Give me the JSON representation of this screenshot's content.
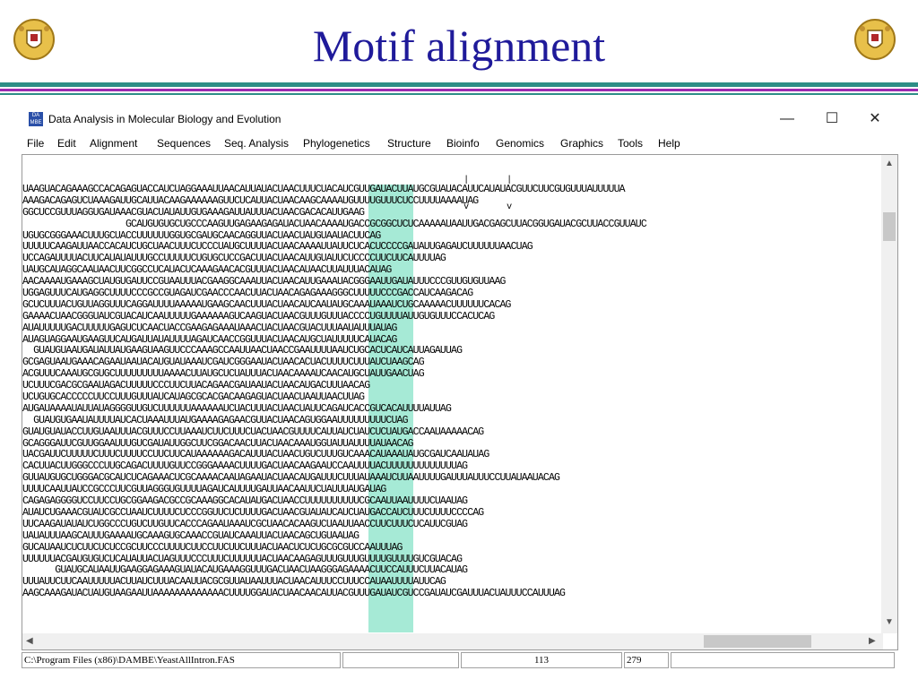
{
  "slide": {
    "title": "Motif alignment"
  },
  "window": {
    "title": "Data Analysis in Molecular Biology and Evolution",
    "icon_text": "DA MBE",
    "minimize": "—",
    "maximize": "☐",
    "close": "✕"
  },
  "menu": [
    "File",
    "Edit",
    "Alignment",
    "Sequences",
    "Seq. Analysis",
    "Phylogenetics",
    "Structure",
    "Bioinfo",
    "Genomics",
    "Graphics",
    "Tools",
    "Help"
  ],
  "markers": {
    "bars": "                                                                                  |       |",
    "arrows": "                                                                                  v       v"
  },
  "sequences": [
    "UAAGUACAGAAAGCCACAGAGUACCAUCUAGGAAAUUAACAUUAUACUAACUUUCUACAUCGUUGAUACUUAUGCGUAUACAUUCAUAUACGUUCUUCGUGUUUAUUUUUA",
    "AAAGACAGAGUCUAAAGAUUGCAUUACAAGAAAAAAGUUCUCAUUACUAACAAGCAAAAUGUUUUGUUUCUCCUUUUAAAAUAG",
    "GGCUCCGUUUAGGUGAUAAACGUACUAUAUUGUGAAAGAUUAUUUACUAACGACACAUUGAAG",
    "                   GCAUGUGUGCUGCCCAAGUUGAGAAGAGAUACUAACAAAAUGACCGCGGCUCUCAAAAAUAAUUGACGAGCUUACGGUGAUACGCUUACCGUUAUC",
    "UGUGCGGGAAACUUUGCUACCUUUUUUGGUGCGAUGCAACAGGUUACUAACUAUGUAAUACUUCAG",
    "UUUUUCAAGAUUAACCACAUCUGCUAACUUUCUCCCUAUGCUUUUACUAACAAAAUUAUUCUCACUCCCCGAUAUUGAGAUCUUUUUUAACUAG",
    "UCCAGAUUUUACUUCAUAUAUUUGCCUUUUUCUGUGCUCCGACUUACUAACAUUGUAUUCUCCCCUUCUUCAUUUUAG",
    "UAUGCAUAGGCAAUAACUUCGGCCUCAUACUCAAAGAACACGUUUACUAACAUAACUUAUUUACAUAG",
    "AACAAAAUGAAAGCUAUGUGAUUCCGUAAUUUACGAAGGCAAAUUACUAACAUUGAAAUACGGGAAUUGAUAUUUCCCGUUGUGUUAAG",
    "UGGAGUUUCAUGAGGCUUUUCCCGCCGUAGAUCGAACCCAACUUACUAACAGAGAAAGGGCUUUUUCCCGACCAUCAAGACAG",
    "GCUCUUUACUGUUAGGUUUCAGGAUUUUAAAAAUGAAGCAACUUUACUAACAUCAAUAUGCAAAUAAAUCUGCAAAAACUUUUUUCACAG",
    "GAAAACUAACGGGUAUCGUACAUCAAUUUUUGAAAAAAGUCAAGUACUAACGUUUGUUUACCCCUGUUUUAUUGUGUUUCCACUCAG",
    "AUAUUUUUGACUUUUUGAGUCUCAACUACCGAAGAGAAAUAAACUACUAACGUACUUUAAUAUUUAUAG",
    "AUAGUAGGAAUGAAGUUCAUGAUUAUAUUUUAGAUCAACCGGUUUACUAACAUGCUAUUUUUCAUACAG",
    "  GUAUGUAAUGAUAUUAUGAAGUAAGUUCCCAAAGCCAAUUAACUAACCGAAUUUUAAUCUGCACUCAUCAUUAGAUUAG",
    "GCGAGUAAUGAAACAGAAUAAUACAUGUAUAAAUCGAUCGGGAAUACUAACACUACUUUUCUUUAUCUAAGCAG",
    "ACGUUUCAAAUGCGUGCUUUUUUUUUAAAACUUAUGCUCUAUUUACUAACAAAAUCAACAUGCUAUUGAACUAG",
    "UCUUUCGACGCGAAUAGACUUUUUCCCUUCUUACAGAACGAUAAUACUAACAUGACUUUAACAG",
    "UCUGUGCACCCCCUUCCUUUGUUUAUCAUAGCGCACGACAAGAGUACUAACUAAUUAACUUAG",
    "AUGAUAAAAUAUUAUAGGGGUUGUCUUUUUUAAAAAAUCUACUUUACUAACUAUUCAGAUCACCGUCACAUUUUAUUAG",
    "  GUAUGUGAAUAUUUUAUCACUAAAUUUAUGAAAAGAGAACGUUACUAACAGUGGAAUUUUUUUUUCUAG",
    "GUAUGUAUACCUUGUAAUUUACGUUUCCUUAAAUCUUCUUUCUACUAACGUUUUCAUUAUCUAUCUCUAUGACCAAUAAAAACAG",
    "GCAGGGAUUCGUUGGAAUUUGUCGAUAUUGGCUUCGGACAACUUACUAACAAAUGGUAUUAUUUUAUAACAG",
    "UACGAUUCUUUUUCUUUCUUUUCCUUCUUCAUAAAAAAGACAUUUACUAACUGUCUUUGUCAAACAUAAAUAUGCGAUCAAUAUAG",
    "CACUUACUUGGGCCCUUGCAGACUUUUGUUCCGGGAAAACUUUUGACUAACAAGAAUCCAAUUUUACUUUUUUUUUUUUUAG",
    "GUUAUGUGCUGGGACGCAUCUCAGAAACUCGCAAAACAAUAGAAUACUAACAUGAUUUCUUUAUAAAUCUUAAUUUUGAUUUAUUUCCUUAUAAUACAG",
    "UUUUCAAUUAUCCGCCCUUCGUUAGGGUGUUUUAGAUCAUUUUGAUUAACAAUUCUAUUUAUGAUAG",
    "CAGAGAGGGGUCCUUCCUGCGGAAGACGCCGCAAAGGCACAUAUGACUAACCUUUUUUUUUUCGCAAUUAAUUUUCUAAUAG",
    "AUAUCUGAAACGUAUCGCCUAAUCUUUUCUCCCGGUUCUCUUUUGACUAACGUAUAUCAUCUAUGACCAUCUUUCUUUUCCCCAG",
    "UUCAAGAUAUAUCUGGCCCUGUCUUGUUCACCCAGAAUAAAUCGCUAACACAAGUCUAAUUAACCUUCUUUCUCAUUCGUAG",
    "UAUAUUUAAGCAUUUGAAAAUGCAAAGUGCAAACCGUAUCAAAUUACUAACAGCUGUAAUAG",
    "GUCAUAAUCUCUUCUCUCCGCUUCCCUUUUCUUCCUUCUUCUUUACUAACUCUCUGCGCGUCCAAUUUAG",
    "UUUUUUACGAUGUGUCUCAUAUUACUAGUUUCCCUUUCUUUUUUACUAACAAGAGUUUGUUUGUUUUGUUUUGUCGUACAG",
    "      GUAUGCAUAAUUGAAGGAGAAAGUAUACAUGAAAGGUUUGACUAACUAAGGGAGAAAACUUCCAUUUCUUACAUAG",
    "UUUAUUCUUCAAUUUUUACUUAUCUUUACAAUUACGCGUUAUAAUUUACUAACAUUUCCUUUCCAUAAUUUUAUUCAG",
    "AAGCAAAGAUACUAUGUAAGAAUUAAAAAAAAAAAAACUUUUGGAUACUAACAACAUUACGUUUGAUAUCGUCCGAUAUCGAUUUACUAUUUCCAUUUAG"
  ],
  "status": {
    "path": "C:\\Program Files (x86)\\DAMBE\\YeastAllIntron.FAS",
    "count": "113",
    "position": "279"
  }
}
